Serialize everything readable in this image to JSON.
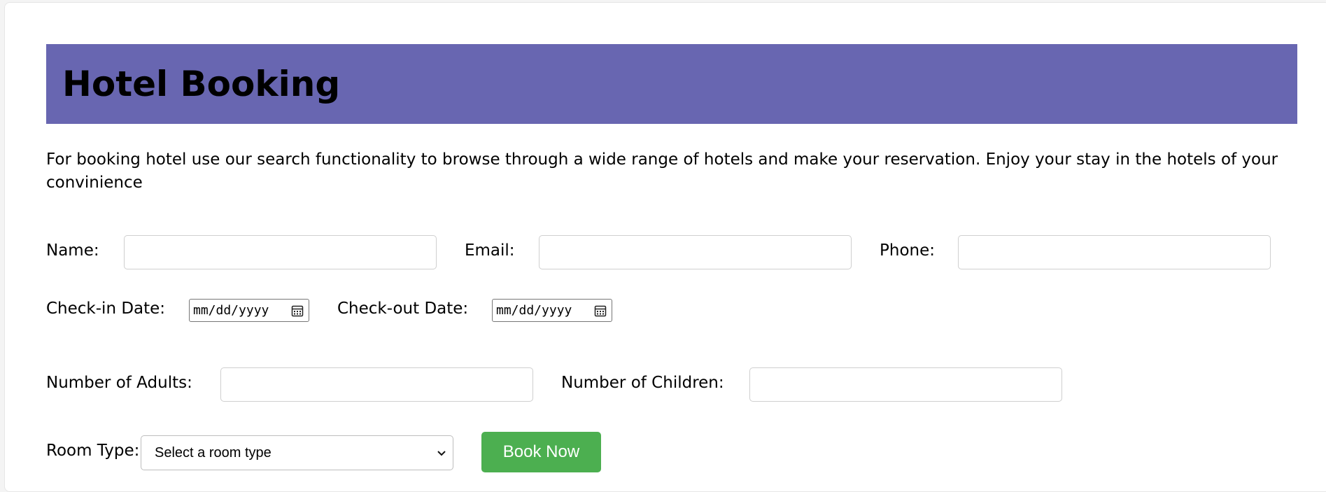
{
  "header": {
    "title": "Hotel Booking",
    "background_color": "#6866b1"
  },
  "intro": {
    "text": "For booking hotel use our search functionality to browse through a wide range of hotels and make your reservation. Enjoy your stay in the hotels of your convinience"
  },
  "form": {
    "name_label": "Name:",
    "name_value": "",
    "email_label": "Email:",
    "email_value": "",
    "phone_label": "Phone:",
    "phone_value": "",
    "checkin_label": "Check-in Date:",
    "checkin_placeholder": "mm/dd/yyyy",
    "checkout_label": "Check-out Date:",
    "checkout_placeholder": "mm/dd/yyyy",
    "adults_label": "Number of Adults:",
    "adults_value": "",
    "children_label": "Number of Children:",
    "children_value": "",
    "room_type_label": "Room Type:",
    "room_type_selected": "Select a room type",
    "submit_label": "Book Now",
    "submit_color": "#4caf50"
  },
  "icons": {
    "date_icon": "calendar-icon",
    "select_icon": "chevron-down-icon"
  }
}
